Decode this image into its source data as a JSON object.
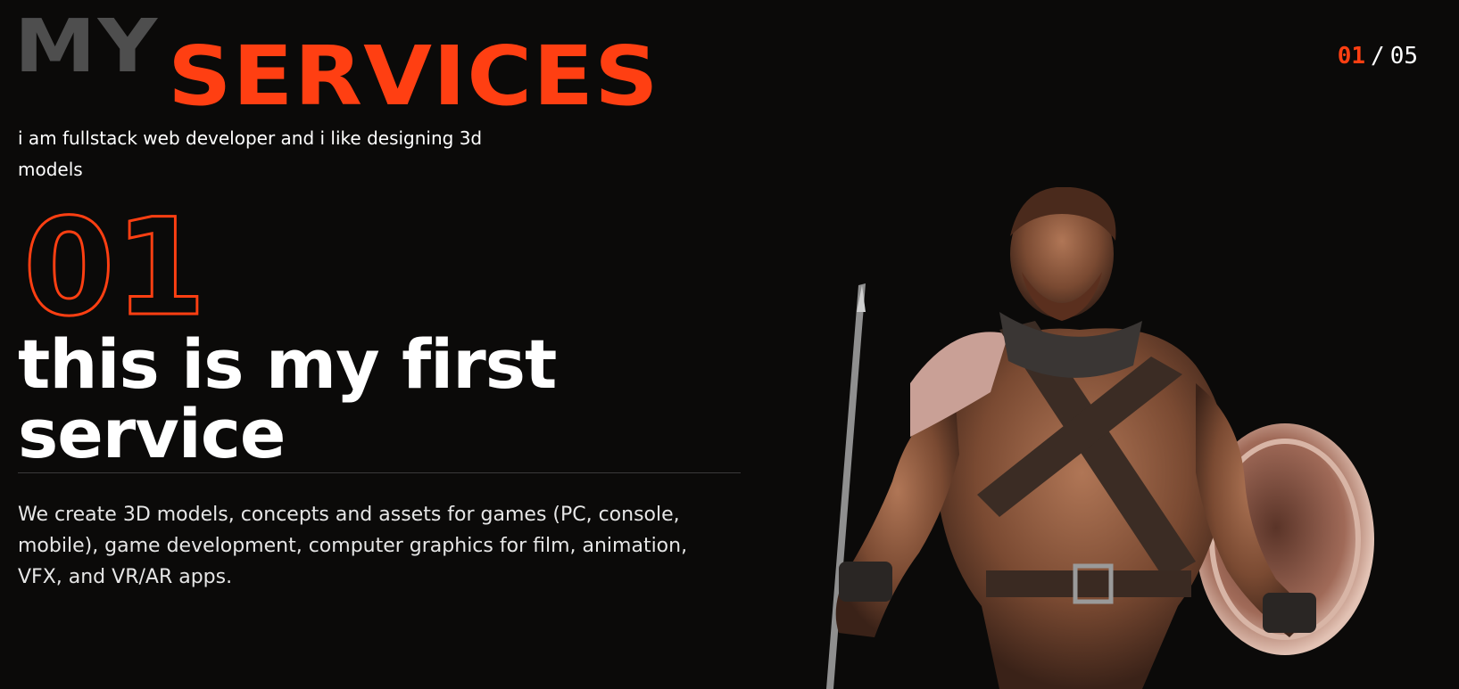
{
  "header": {
    "title_primary": "MY",
    "title_accent": "SERVICES",
    "subtitle": "i am fullstack web developer and i like designing 3d models"
  },
  "pagination": {
    "current": "01",
    "separator": "/",
    "total": "05"
  },
  "service": {
    "number": "01",
    "title": "this is my first service",
    "description": "We create 3D models, concepts and assets for games (PC, console, mobile), game development, computer graphics for film, animation, VFX, and VR/AR apps."
  },
  "colors": {
    "accent": "#ff3f12",
    "background": "#0b0a09",
    "muted_title": "#4e4e4e",
    "text": "#ffffff"
  },
  "icons": {
    "hero": "warrior-figure"
  }
}
